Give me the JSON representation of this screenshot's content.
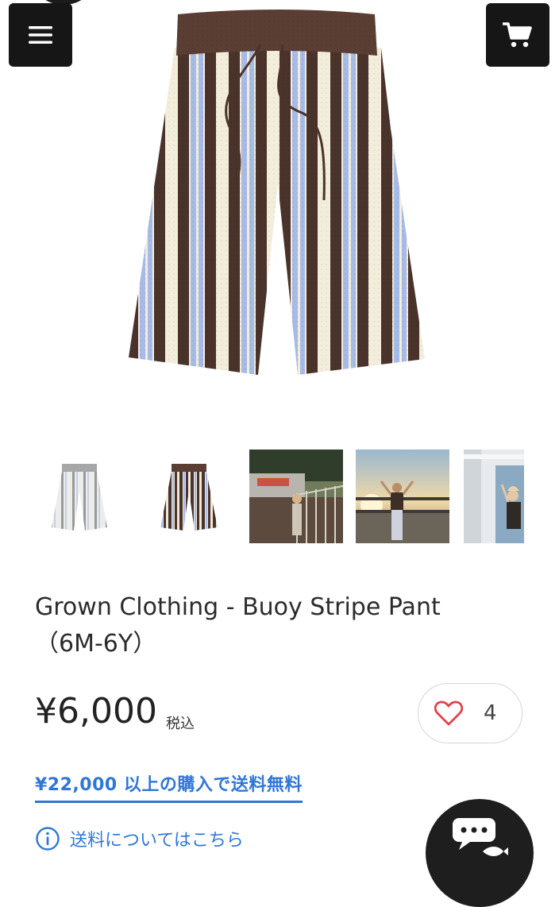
{
  "header": {
    "menu_icon": "hamburger-menu-icon",
    "cart_icon": "shopping-cart-icon"
  },
  "product": {
    "title_line1": "Grown Clothing - Buoy Stripe Pant",
    "title_line2": "（6M-6Y）",
    "price": "¥6,000",
    "tax_label": "税込",
    "like_count": "4",
    "colors": {
      "cream": "#f3eedc",
      "brown": "#4a332b",
      "blue": "#a7bbe8",
      "waistband": "#5a3e33",
      "accent": "#2f77d6",
      "heart": "#e0434c"
    }
  },
  "gallery": {
    "thumbnails": [
      "thumbnail-pant-grey",
      "thumbnail-pant-brown",
      "thumbnail-photo-child-stairs",
      "thumbnail-photo-child-sunset",
      "thumbnail-photo-child-doorway"
    ]
  },
  "shipping": {
    "promo_text": "¥22,000 以上の購入で送料無料",
    "info_link": "送料についてはこちら"
  },
  "chat": {
    "icon": "chat-icon"
  }
}
